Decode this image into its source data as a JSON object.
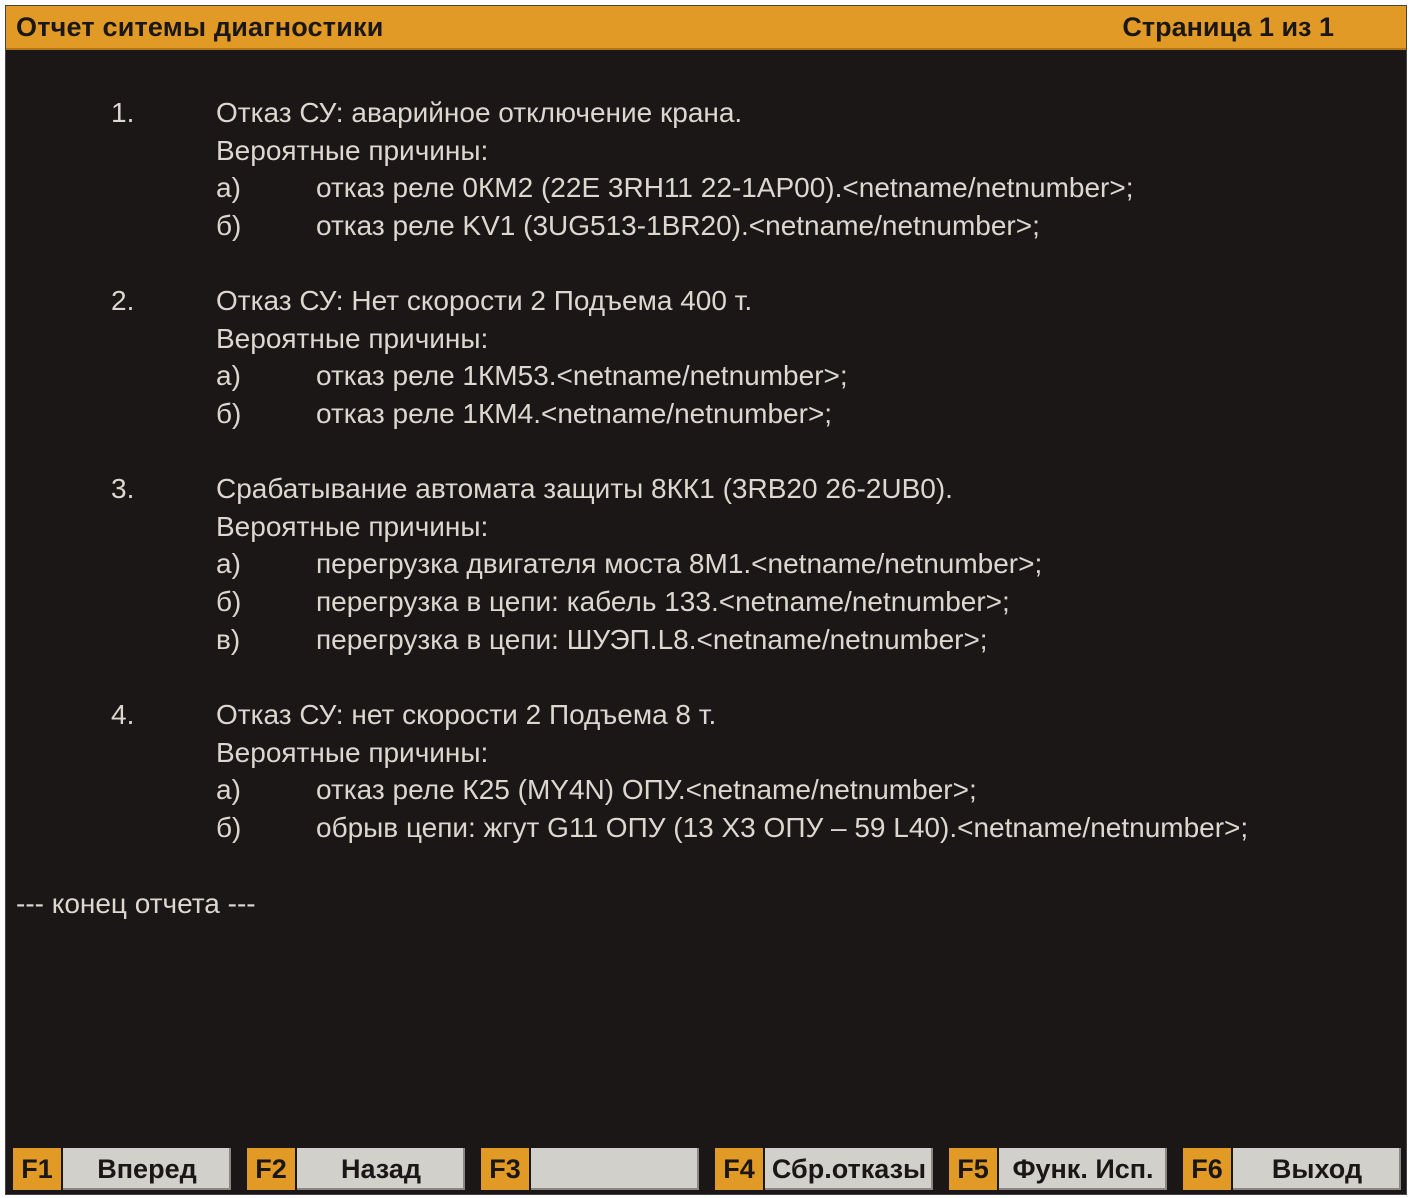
{
  "header": {
    "title": "Отчет ситемы диагностики",
    "page": "Страница 1 из 1"
  },
  "report": {
    "entries": [
      {
        "number": "1.",
        "text": "Отказ СУ: аварийное отключение крана.",
        "causes_label": "Вероятные причины:",
        "causes": [
          {
            "letter": "а)",
            "text": "отказ реле 0КМ2 (22E 3RH11 22-1AP00).<netname/netnumber>;"
          },
          {
            "letter": "б)",
            "text": "отказ реле KV1 (3UG513-1BR20).<netname/netnumber>;"
          }
        ]
      },
      {
        "number": "2.",
        "text": "Отказ СУ: Нет скорости 2 Подъема 400 т.",
        "causes_label": "Вероятные причины:",
        "causes": [
          {
            "letter": "а)",
            "text": "отказ реле 1КМ53.<netname/netnumber>;"
          },
          {
            "letter": "б)",
            "text": "отказ реле 1КМ4.<netname/netnumber>;"
          }
        ]
      },
      {
        "number": "3.",
        "text": "Срабатывание автомата защиты 8КК1 (3RB20 26-2UB0).",
        "causes_label": "Вероятные причины:",
        "causes": [
          {
            "letter": "а)",
            "text": "перегрузка двигателя моста 8М1.<netname/netnumber>;"
          },
          {
            "letter": "б)",
            "text": "перегрузка в цепи: кабель 133.<netname/netnumber>;"
          },
          {
            "letter": "в)",
            "text": "перегрузка в цепи: ШУЭП.L8.<netname/netnumber>;"
          }
        ]
      },
      {
        "number": "4.",
        "text": "Отказ СУ: нет скорости 2 Подъема 8 т.",
        "causes_label": "Вероятные причины:",
        "causes": [
          {
            "letter": "а)",
            "text": "отказ реле К25 (MY4N) ОПУ.<netname/netnumber>;"
          },
          {
            "letter": "б)",
            "text": "обрыв цепи: жгут G11 ОПУ (13 Х3 ОПУ –  59 L40).<netname/netnumber>;"
          }
        ]
      }
    ],
    "end_text": "--- конец отчета ---"
  },
  "footer": {
    "keys": [
      {
        "code": "F1",
        "label": "Вперед"
      },
      {
        "code": "F2",
        "label": "Назад"
      },
      {
        "code": "F3",
        "label": ""
      },
      {
        "code": "F4",
        "label": "Сбр.отказы"
      },
      {
        "code": "F5",
        "label": "Функ. Исп."
      },
      {
        "code": "F6",
        "label": "Выход"
      }
    ]
  },
  "colors": {
    "accent": "#e29a26",
    "background": "#1a1716",
    "text": "#dcd8d0",
    "key_label_bg": "#d2d0cb"
  }
}
